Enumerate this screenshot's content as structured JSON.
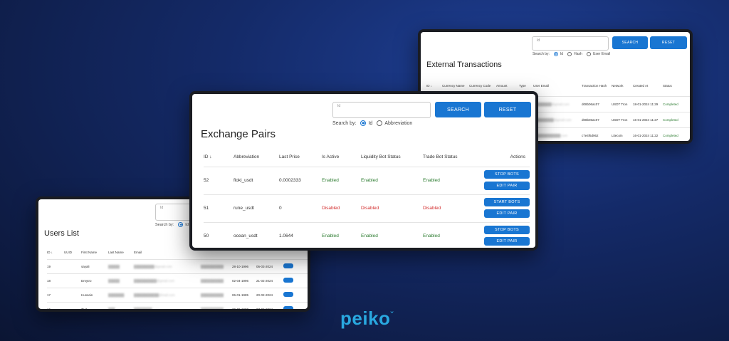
{
  "brand": {
    "logo_text": "peiko"
  },
  "external": {
    "title": "External Transactions",
    "search_placeholder": "Id",
    "search_label": "SEARCH",
    "reset_label": "RESET",
    "search_by": "Search by:",
    "options": [
      "Id",
      "Hash",
      "User Email"
    ],
    "columns": [
      "ID ↓",
      "Currency Name",
      "Currency Code",
      "Amount",
      "Type",
      "User Email",
      "Transaction Hash",
      "Network",
      "Created At",
      "Status"
    ],
    "rows": [
      {
        "hash": "d08b06ac07",
        "network": "USDT Tron",
        "created": "18-01-2024 11:29",
        "status": "Completed"
      },
      {
        "hash": "d08b06ac07",
        "network": "USDT Tron",
        "created": "16-01-2024 11:27",
        "status": "Completed"
      },
      {
        "hash": "c7e4f6d962",
        "network": "Litecoin",
        "created": "16-01-2024 11:22",
        "status": "Completed"
      }
    ]
  },
  "exchange": {
    "title": "Exchange Pairs",
    "search_placeholder": "Id",
    "search_label": "SEARCH",
    "reset_label": "RESET",
    "search_by": "Search by:",
    "options": [
      "Id",
      "Abbreviation"
    ],
    "columns": [
      "ID ↓",
      "Abbreviation",
      "Last Price",
      "Is Active",
      "Liquidity Bot Status",
      "Trade Bot Status",
      "Actions"
    ],
    "rows": [
      {
        "id": "52",
        "abbr": "floki_usdt",
        "price": "0.0002333",
        "active": "Enabled",
        "liq": "Enabled",
        "trade": "Enabled",
        "bots_btn": "STOP BOTS",
        "edit_btn": "EDIT PAIR"
      },
      {
        "id": "51",
        "abbr": "rune_usdt",
        "price": "0",
        "active": "Disabled",
        "liq": "Disabled",
        "trade": "Disabled",
        "bots_btn": "START BOTS",
        "edit_btn": "EDIT PAIR"
      },
      {
        "id": "50",
        "abbr": "ocean_usdt",
        "price": "1.0644",
        "active": "Enabled",
        "liq": "Enabled",
        "trade": "Enabled",
        "bots_btn": "STOP BOTS",
        "edit_btn": "EDIT PAIR"
      }
    ]
  },
  "users": {
    "title": "Users List",
    "search_placeholder": "Id",
    "search_by": "Search by:",
    "option": "Id",
    "columns": [
      "ID ↓",
      "UUID",
      "First Name",
      "Last Name",
      "Email"
    ],
    "rows": [
      {
        "id": "19",
        "first": "sayali",
        "birth": "28-10-1996",
        "reg": "06-03-2024"
      },
      {
        "id": "18",
        "first": "Dmytro",
        "birth": "02-04-1996",
        "reg": "21-02-2024"
      },
      {
        "id": "17",
        "first": "Hussain",
        "birth": "06-01-1985",
        "reg": "20-02-2024"
      },
      {
        "id": "16",
        "first": "Test",
        "birth": "29-02-1900",
        "reg": "07-02-2024"
      }
    ]
  },
  "colors": {
    "primary": "#1976d2",
    "enabled": "#2e7d32",
    "disabled": "#d32f2f",
    "logo": "#29a8e0"
  }
}
